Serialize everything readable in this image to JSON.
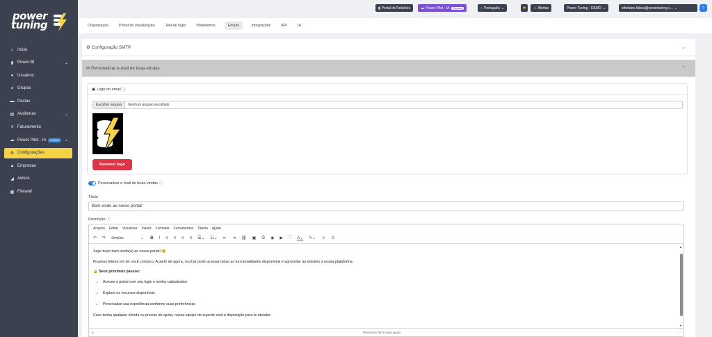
{
  "brand": {
    "line1": "power",
    "line2": "tuning",
    "tagline": "—"
  },
  "sidebar": {
    "items": [
      {
        "icon": "home-icon",
        "glyph": "⌂",
        "label": "Início"
      },
      {
        "icon": "chart-icon",
        "glyph": "▮",
        "label": "Power BI",
        "chevron": true
      },
      {
        "icon": "user-icon",
        "glyph": "●",
        "label": "Usuários"
      },
      {
        "icon": "users-icon",
        "glyph": "✦",
        "label": "Grupos"
      },
      {
        "icon": "folder-icon",
        "glyph": "▬",
        "label": "Pastas"
      },
      {
        "icon": "audit-icon",
        "glyph": "▤",
        "label": "Auditorias",
        "chevron": true
      },
      {
        "icon": "billing-icon",
        "glyph": "≡",
        "label": "Faturamento"
      },
      {
        "icon": "robot-icon",
        "glyph": "☁",
        "label": "Power Pilot - IA",
        "badge": "Preview",
        "chevron": true
      },
      {
        "icon": "gear-icon",
        "glyph": "⚙",
        "label": "Configurações",
        "active": true
      },
      {
        "icon": "building-icon",
        "glyph": "▲",
        "label": "Empresas"
      },
      {
        "icon": "megaphone-icon",
        "glyph": "◢",
        "label": "Avisos"
      },
      {
        "icon": "firewall-icon",
        "glyph": "▦",
        "label": "Firewall"
      }
    ]
  },
  "topbar": {
    "portal": "Portal de Relatório",
    "pilot": "Power Pilot - IA",
    "pilot_badge": "Preview",
    "language": "Português",
    "alerts": "Alertas",
    "company": "Power Tuning - DEMO",
    "user": "sthefane.lisboa@powertuning.c..."
  },
  "tabs": [
    "Organização",
    "Portal de visualização",
    "Tela de login",
    "Parâmetros",
    "Emails",
    "Integrações",
    "API",
    "IA"
  ],
  "active_tab": "Emails",
  "accordion": {
    "smtp": "Configuração SMTP",
    "welcome": "Personalizar e-mail de boas-vindas"
  },
  "logo_section": {
    "title": "Logo do email",
    "file_button": "Escolher arquivo",
    "file_status": "Nenhum arquivo escolhido",
    "remove_button": "Remover logo"
  },
  "toggle_label": "Personalizar e-mail de boas-vindas",
  "title_field": {
    "label": "Título",
    "value": "Bem vindo ao nosso portal!"
  },
  "description": {
    "label": "Descrição",
    "menu": [
      "Arquivo",
      "Editar",
      "Visualizar",
      "Inserir",
      "Formatar",
      "Ferramentas",
      "Tabela",
      "Ajuda"
    ],
    "style_select": "Simples",
    "body": {
      "greeting": "Seja muito bem-vindo(a) ao nosso portal! 😊",
      "intro": "Ficamos felizes em ter você conosco. A partir de agora, você já pode acessar todas as funcionalidades disponíveis e aproveitar ao máximo a nossa plataforma.",
      "steps_title": "🔒 Seus próximos passos:",
      "steps": [
        "Acesse o portal com seu login e senha cadastrados",
        "Explore os recursos disponíveis",
        "Personalize sua experiência conforme suas preferências"
      ],
      "closing": "Caso tenha qualquer dúvida ou precise de ajuda, nossa equipe de suporte está à disposição para te atender."
    },
    "status_path": "p",
    "status_help": "Pressione Alt+0 para ajuda"
  }
}
